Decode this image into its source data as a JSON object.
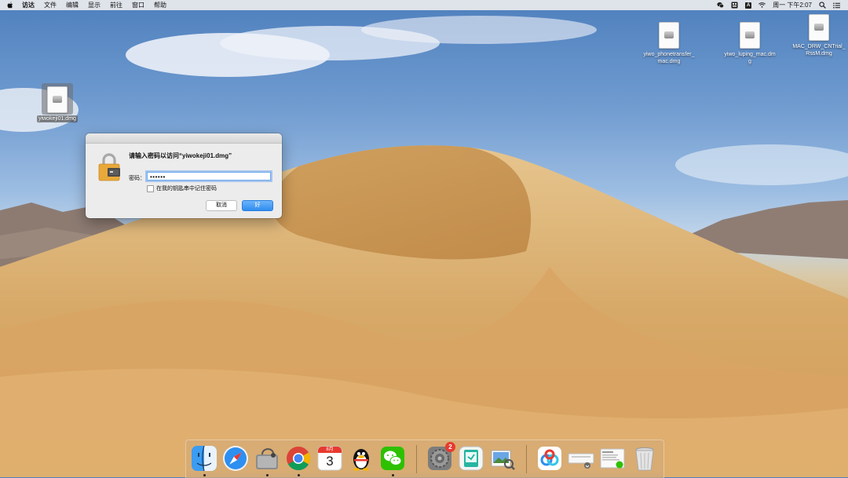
{
  "menubar": {
    "apple_icon": "apple-icon",
    "menus": [
      "访达",
      "文件",
      "编辑",
      "显示",
      "前往",
      "窗口",
      "帮助"
    ],
    "status_icons": [
      "wechat-icon",
      "keyboard-icon",
      "input-method-icon",
      "wifi-icon"
    ],
    "input_method_glyph": "A",
    "clock": "周一 下午2:07",
    "right_icons": [
      "spotlight-search-icon",
      "notification-center-icon"
    ]
  },
  "desktop": {
    "icons": [
      {
        "label": "yiwokeji01.dmg",
        "selected": true
      },
      {
        "label": "yiwo_phonetransfer_mac.dmg",
        "selected": false
      },
      {
        "label": "yiwo_luping_mac.dmg",
        "selected": false
      },
      {
        "label": "MAC_DRW_CNTrial_RssM.dmg",
        "selected": false
      }
    ]
  },
  "dialog": {
    "message": "请输入密码以访问“yiwokeji01.dmg”",
    "password_label": "密码：",
    "password_value": "••••••",
    "remember_label": "在我的钥匙串中记住密码",
    "remember_checked": false,
    "cancel_label": "取消",
    "ok_label": "好"
  },
  "dock": {
    "items": [
      {
        "name": "finder",
        "running": true
      },
      {
        "name": "safari",
        "running": false
      },
      {
        "name": "disk-utility",
        "running": true
      },
      {
        "name": "chrome",
        "running": true
      },
      {
        "name": "calendar",
        "running": false,
        "month": "8月",
        "day": "3"
      },
      {
        "name": "qq",
        "running": false
      },
      {
        "name": "wechat",
        "running": true
      },
      {
        "name": "system-preferences",
        "running": false,
        "badge": "2"
      },
      {
        "name": "app-installer",
        "running": false
      },
      {
        "name": "preview",
        "running": false
      },
      {
        "name": "baidu-netdisk",
        "running": false
      },
      {
        "name": "downloads-stack",
        "running": false
      },
      {
        "name": "documents-stack",
        "running": false
      },
      {
        "name": "trash",
        "running": false
      }
    ]
  },
  "colors": {
    "accent": "#2f8df0",
    "badge": "#e8392f"
  }
}
